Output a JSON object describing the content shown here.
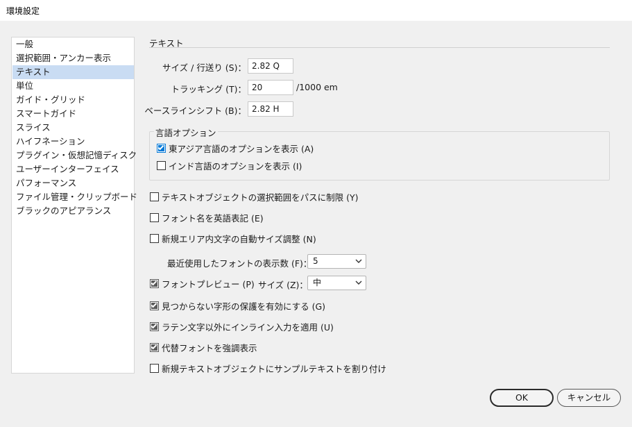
{
  "window": {
    "title": "環境設定"
  },
  "sidebar": {
    "items": [
      {
        "label": "一般"
      },
      {
        "label": "選択範囲・アンカー表示"
      },
      {
        "label": "テキスト",
        "selected": true
      },
      {
        "label": "単位"
      },
      {
        "label": "ガイド・グリッド"
      },
      {
        "label": "スマートガイド"
      },
      {
        "label": "スライス"
      },
      {
        "label": "ハイフネーション"
      },
      {
        "label": "プラグイン・仮想記憶ディスク"
      },
      {
        "label": "ユーザーインターフェイス"
      },
      {
        "label": "パフォーマンス"
      },
      {
        "label": "ファイル管理・クリップボード"
      },
      {
        "label": "ブラックのアピアランス"
      }
    ]
  },
  "text_section": {
    "title": "テキスト",
    "size_leading": {
      "label": "サイズ / 行送り (S)：",
      "value": "2.82 Q"
    },
    "tracking": {
      "label": "トラッキング (T)：",
      "value": "20",
      "unit": "/1000 em"
    },
    "baseline_shift": {
      "label": "ベースラインシフト (B)：",
      "value": "2.82 H"
    }
  },
  "language_options": {
    "legend": "言語オプション",
    "east_asian": {
      "label": "東アジア言語のオプションを表示 (A)",
      "checked": true
    },
    "indic": {
      "label": "インド言語のオプションを表示 (I)",
      "checked": false
    }
  },
  "options": {
    "limit_selection_to_path": {
      "label": "テキストオブジェクトの選択範囲をパスに制限 (Y)",
      "checked": false
    },
    "font_names_english": {
      "label": "フォント名を英語表記 (E)",
      "checked": false
    },
    "auto_size_area_type": {
      "label": "新規エリア内文字の自動サイズ調整 (N)",
      "checked": false
    },
    "recent_fonts": {
      "label": "最近使用したフォントの表示数 (F)：",
      "value": "5"
    },
    "font_preview": {
      "label": "フォントプレビュー (P)",
      "checked": true,
      "size_label": "サイズ (Z)：",
      "size_value": "中"
    },
    "missing_glyph_protection": {
      "label": "見つからない字形の保護を有効にする (G)",
      "checked": true
    },
    "inline_input_non_latin": {
      "label": "ラテン文字以外にインライン入力を適用 (U)",
      "checked": true
    },
    "highlight_substituted_fonts": {
      "label": "代替フォントを強調表示",
      "checked": true
    },
    "fill_placeholder_text": {
      "label": "新規テキストオブジェクトにサンプルテキストを割り付け",
      "checked": false
    }
  },
  "buttons": {
    "ok": "OK",
    "cancel": "キャンセル"
  },
  "colors": {
    "accent": "#0078d7",
    "selection": "#c9dcf3"
  }
}
